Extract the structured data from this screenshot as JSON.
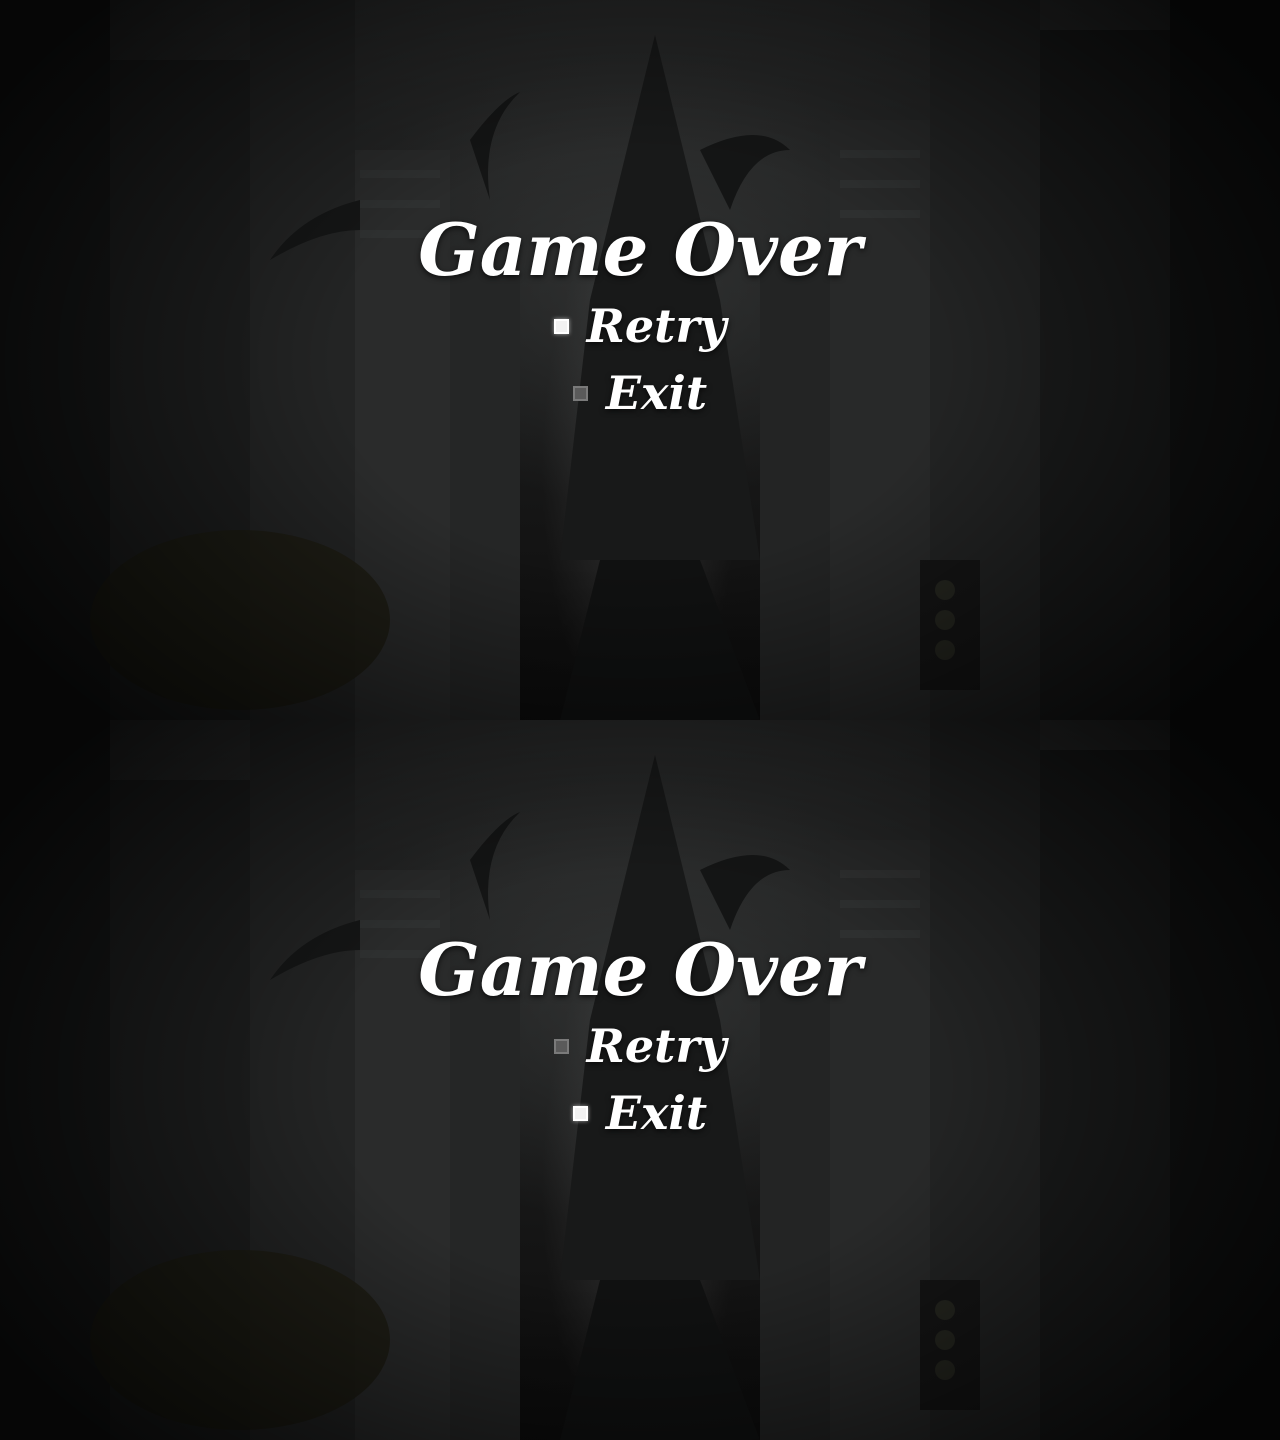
{
  "screens": [
    {
      "title": "Game Over",
      "options": [
        {
          "label": "Retry",
          "selected": true
        },
        {
          "label": "Exit",
          "selected": false
        }
      ]
    },
    {
      "title": "Game Over",
      "options": [
        {
          "label": "Retry",
          "selected": false
        },
        {
          "label": "Exit",
          "selected": true
        }
      ]
    }
  ],
  "colors": {
    "text": "#ffffff",
    "marker_selected": "#f2f2f2",
    "marker_unselected": "#5a5a5a"
  },
  "icons": {
    "marker": "square-marker-icon"
  }
}
